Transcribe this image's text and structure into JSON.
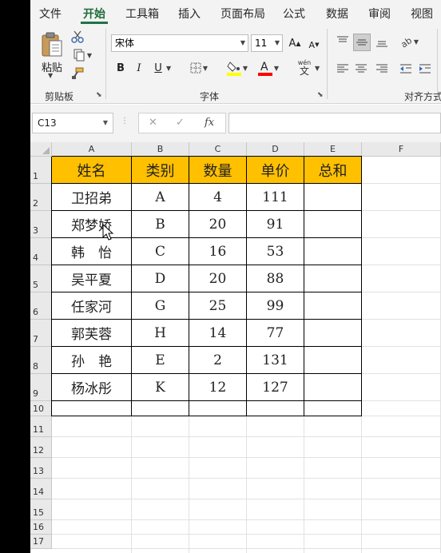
{
  "ribbon_tabs": [
    "文件",
    "开始",
    "工具箱",
    "插入",
    "页面布局",
    "公式",
    "数据",
    "审阅",
    "视图"
  ],
  "active_tab": "开始",
  "clipboard": {
    "paste_label": "粘贴",
    "group_label": "剪贴板"
  },
  "font": {
    "name": "宋体",
    "size": "11",
    "group_label": "字体",
    "bold": "B",
    "italic": "I",
    "underline": "U",
    "phonetic": "wén"
  },
  "alignment": {
    "group_label": "对齐方式"
  },
  "formula_bar": {
    "name_box": "C13",
    "cancel": "✕",
    "enter": "✓",
    "fx": "fx",
    "formula": ""
  },
  "columns": [
    "A",
    "B",
    "C",
    "D",
    "E",
    "F"
  ],
  "rows": [
    "1",
    "2",
    "3",
    "4",
    "5",
    "6",
    "7",
    "8",
    "9",
    "10",
    "11",
    "12",
    "13",
    "14",
    "15",
    "16",
    "17"
  ],
  "table": {
    "headers": [
      "姓名",
      "类别",
      "数量",
      "单价",
      "总和"
    ],
    "rows": [
      [
        "卫招弟",
        "A",
        "4",
        "111",
        ""
      ],
      [
        "郑梦娇",
        "B",
        "20",
        "91",
        ""
      ],
      [
        "韩　怡",
        "C",
        "16",
        "53",
        ""
      ],
      [
        "吴平夏",
        "D",
        "20",
        "88",
        ""
      ],
      [
        "任家河",
        "G",
        "25",
        "99",
        ""
      ],
      [
        "郭芙蓉",
        "H",
        "14",
        "77",
        ""
      ],
      [
        "孙　艳",
        "E",
        "2",
        "131",
        ""
      ],
      [
        "杨冰彤",
        "K",
        "12",
        "127",
        ""
      ],
      [
        "",
        "",
        "",
        "",
        ""
      ]
    ]
  },
  "colors": {
    "header_fill": "#ffc000",
    "accent": "#217346",
    "font_color_bar": "#ff0000",
    "highlight_bar": "#ffff00"
  }
}
